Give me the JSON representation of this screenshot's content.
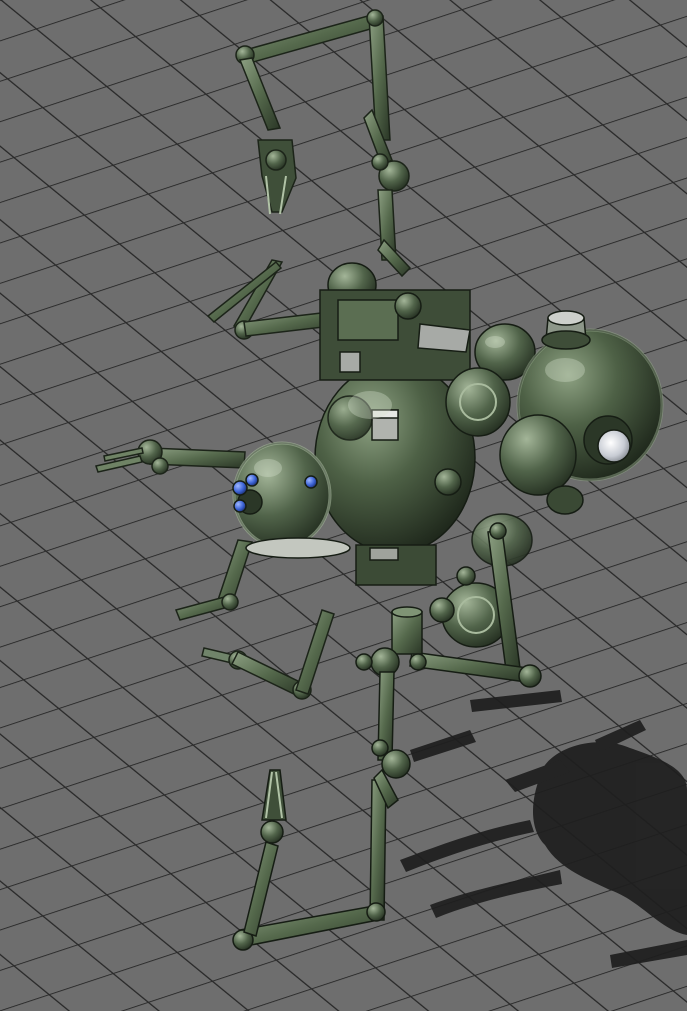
{
  "scene": {
    "subject": "robot-drone",
    "colors": {
      "floor": "#6e6e6e",
      "floor_line": "#2e2e2e",
      "hull_dark": "#2f3d2a",
      "hull_mid": "#4c5f44",
      "hull_light": "#7f9475",
      "highlight": "#b9c8ae",
      "shadow": "#1f1f1f",
      "panel_grey": "#a9aca8",
      "sensor_blue": "#3b62d4",
      "lens_white": "#e8ebf0"
    }
  }
}
